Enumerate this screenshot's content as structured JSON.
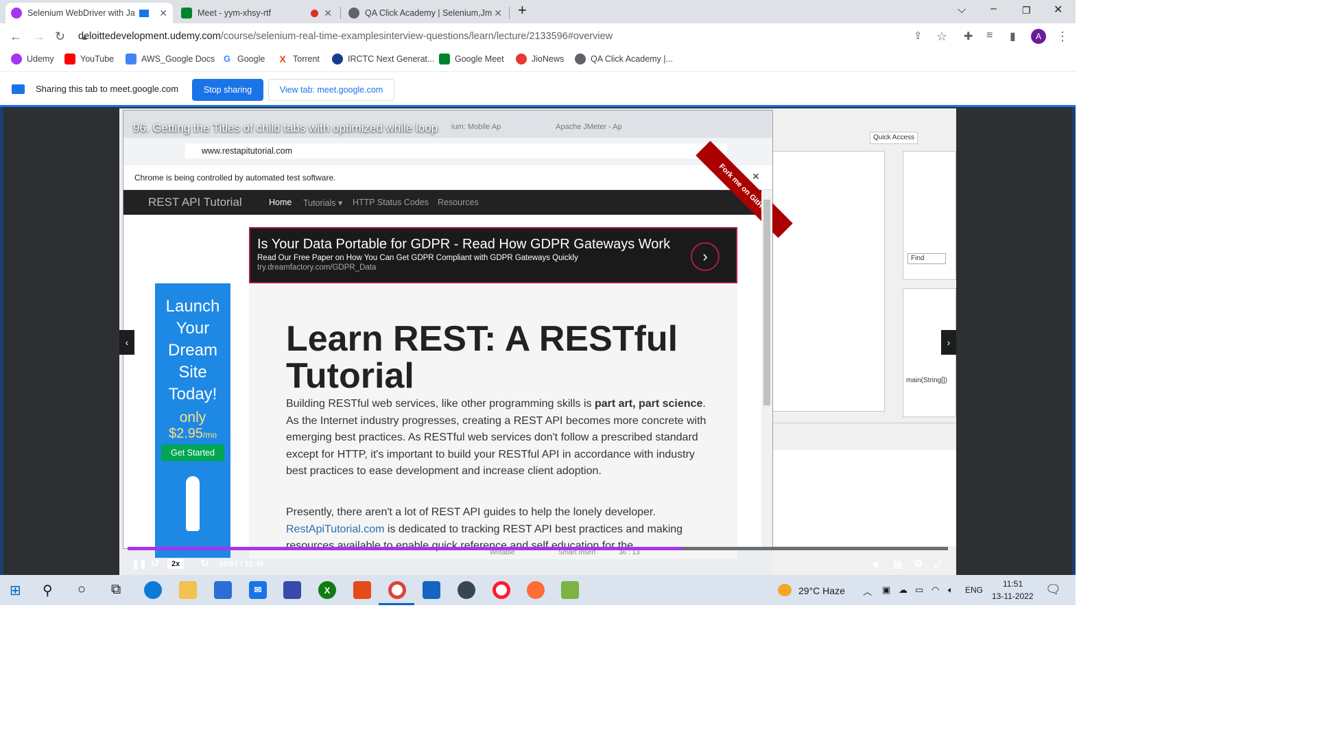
{
  "browser": {
    "tabs": [
      {
        "title": "Selenium WebDriver with Ja",
        "favicon_color": "#a435f0"
      },
      {
        "title": "Meet - yym-xhsy-rtf",
        "favicon_color": "#00832d"
      },
      {
        "title": "QA Click Academy | Selenium,Jm",
        "favicon_color": "#5f6368"
      }
    ],
    "new_tab": "+",
    "url_domain": "deloittedevelopment.udemy.com",
    "url_path": "/course/selenium-real-time-examplesinterview-questions/learn/lecture/2133596#overview",
    "profile_initial": "A"
  },
  "bookmarks": [
    {
      "label": "Udemy",
      "color": "#a435f0"
    },
    {
      "label": "YouTube",
      "color": "#ff0000"
    },
    {
      "label": "AWS_Google Docs",
      "color": "#4285f4"
    },
    {
      "label": "Google",
      "color": "#4285f4"
    },
    {
      "label": "Torrent",
      "color": "#e8470d"
    },
    {
      "label": "IRCTC Next Generat...",
      "color": "#1b3c8b"
    },
    {
      "label": "Google Meet",
      "color": "#00832d"
    },
    {
      "label": "JioNews",
      "color": "#e53935"
    },
    {
      "label": "QA Click Academy |...",
      "color": "#5f6368"
    }
  ],
  "share_bar": {
    "text": "Sharing this tab to meet.google.com",
    "stop_label": "Stop sharing",
    "view_label": "View tab: meet.google.com"
  },
  "video": {
    "title": "96. Getting the Titles of child tabs with optimized while loop",
    "speed": "2x",
    "time": "10:07 / 13:46",
    "progress_fraction": 0.6755,
    "inner_tabs": [
      "ium: Mobile Ap",
      "Apache JMeter - Ap"
    ],
    "inner_url": "www.restapitutorial.com",
    "infobar": "Chrome is being controlled by automated test software.",
    "eclipse": {
      "quick_access": "Quick Access",
      "find": "Find",
      "method": "main(String[])",
      "status_writable": "Writable",
      "status_insert": "Smart Insert",
      "status_pos": "36 : 13"
    }
  },
  "site": {
    "brand": "REST API Tutorial",
    "nav": [
      "Home",
      "Tutorials ▾",
      "HTTP Status Codes",
      "Resources"
    ],
    "fork_ribbon": "Fork me on GitHub",
    "ad": {
      "title": "Is Your Data Portable for GDPR - Read How GDPR Gateways Work",
      "subtitle": "Read Our Free Paper on How You Can Get GDPR Compliant with GDPR Gateways Quickly",
      "url": "try.dreamfactory.com/GDPR_Data"
    },
    "side_ad": {
      "headline": "Launch Your Dream Site Today!",
      "only": "only",
      "price": "$2.95",
      "per": "/mo",
      "button": "Get Started"
    },
    "heading": "Learn REST: A RESTful Tutorial",
    "para1_a": "Building RESTful web services, like other programming skills is ",
    "para1_bold": "part art, part science",
    "para1_b": ". As the Internet industry progresses, creating a REST API becomes more concrete with emerging best practices. As RESTful web services don't follow a prescribed standard except for HTTP, it's important to build your RESTful API in accordance with industry best practices to ease development and increase client adoption.",
    "para2_a": "Presently, there aren't a lot of REST API guides to help the lonely developer. ",
    "para2_link": "RestApiTutorial.com",
    "para2_b": " is dedicated to tracking REST API best practices and making resources available to enable quick reference and self education for the"
  },
  "taskbar": {
    "weather": "29°C  Haze",
    "lang": "ENG",
    "time": "11:51",
    "date": "13-11-2022"
  }
}
